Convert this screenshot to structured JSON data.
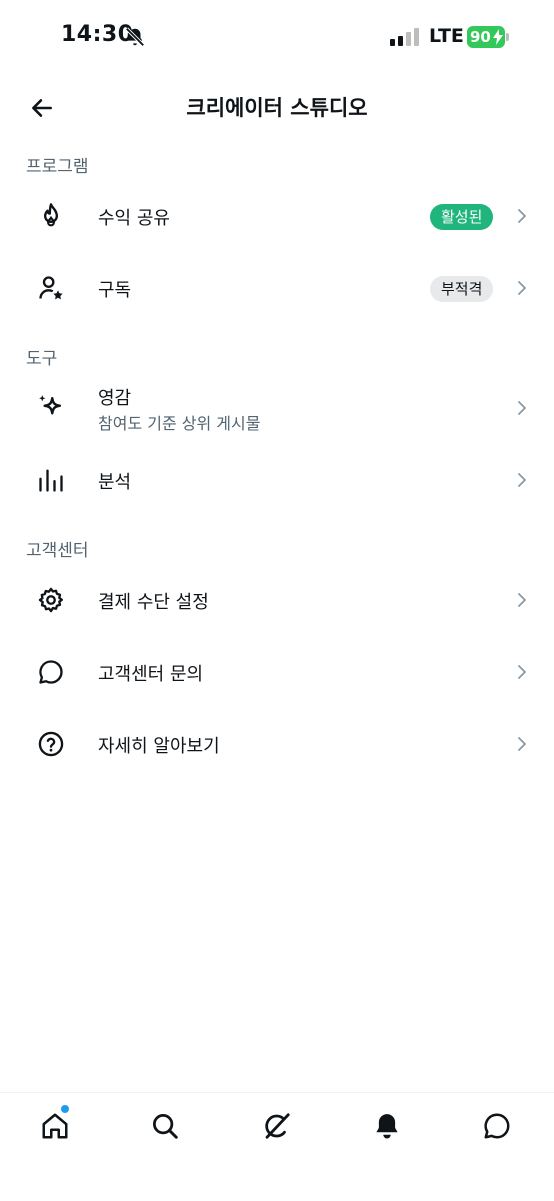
{
  "status_bar": {
    "time": "14:30",
    "network": "LTE",
    "battery": "90"
  },
  "header": {
    "title": "크리에이터 스튜디오"
  },
  "sections": {
    "programs": {
      "label": "프로그램",
      "items": [
        {
          "label": "수익 공유",
          "badge": "활성된",
          "icon": "fire-icon"
        },
        {
          "label": "구독",
          "badge": "부적격",
          "icon": "person-star-icon"
        }
      ]
    },
    "tools": {
      "label": "도구",
      "items": [
        {
          "label": "영감",
          "sublabel": "참여도 기준 상위 게시물",
          "icon": "sparkle-icon"
        },
        {
          "label": "분석",
          "icon": "bar-chart-icon"
        }
      ]
    },
    "support": {
      "label": "고객센터",
      "items": [
        {
          "label": "결제 수단 설정",
          "icon": "gear-icon"
        },
        {
          "label": "고객센터 문의",
          "icon": "chat-bubble-icon"
        },
        {
          "label": "자세히 알아보기",
          "icon": "help-circle-icon"
        }
      ]
    }
  },
  "colors": {
    "active_badge": "#1fb57c",
    "notification_dot": "#1d9bf0",
    "secondary_text": "#536471"
  },
  "tab_bar": [
    "home-icon",
    "search-icon",
    "grok-icon",
    "bell-icon",
    "messages-icon"
  ]
}
